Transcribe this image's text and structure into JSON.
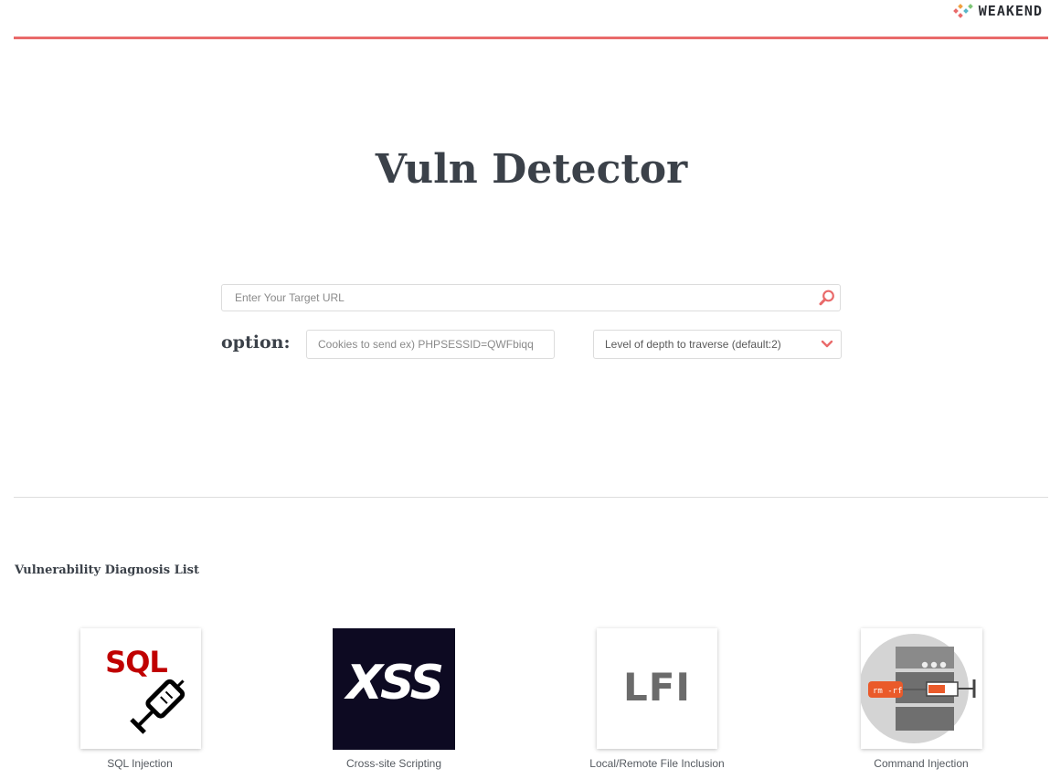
{
  "header": {
    "brand": "WEAKEND"
  },
  "main": {
    "title": "Vuln Detector",
    "search": {
      "placeholder": "Enter Your Target URL",
      "value": ""
    },
    "option_label": "option:",
    "cookies": {
      "placeholder": "Cookies to send ex) PHPSESSID=QWFbiqq",
      "value": ""
    },
    "depth": {
      "selected": "Level of depth to traverse (default:2)"
    }
  },
  "list": {
    "title": "Vulnerability Diagnosis List",
    "items": [
      {
        "label": "SQL Injection",
        "tile_text": "SQL",
        "icon": "syringe-icon"
      },
      {
        "label": "Cross-site Scripting",
        "tile_text": "XSS",
        "icon": "xss-logo"
      },
      {
        "label": "Local/Remote File Inclusion",
        "tile_text": "LFI",
        "icon": "lfi-logo"
      },
      {
        "label": "Command Injection",
        "tile_text": "rm -rf",
        "icon": "server-syringe-icon"
      }
    ]
  },
  "colors": {
    "accent": "#e96a6a",
    "title_text": "#3b4149",
    "xss_bg": "#0d0a22",
    "sql_red": "#c00000"
  }
}
